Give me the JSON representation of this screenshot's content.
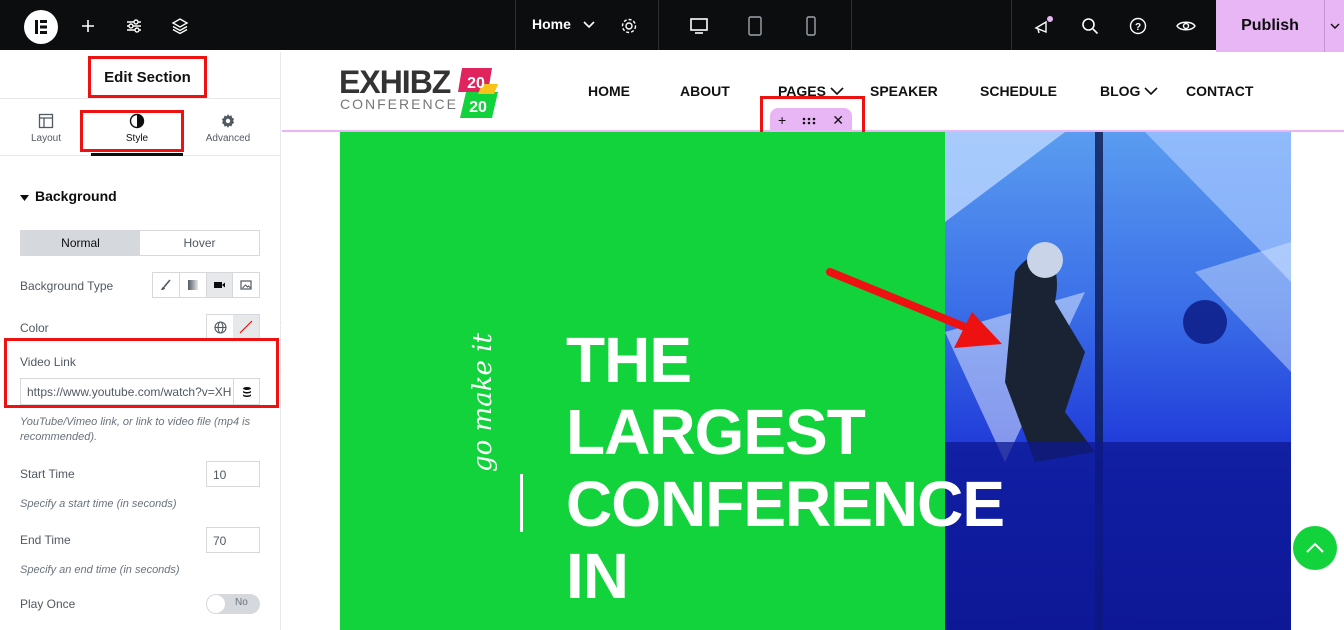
{
  "topbar": {
    "page_name": "Home",
    "publish_label": "Publish"
  },
  "panel": {
    "title": "Edit Section",
    "tabs": [
      {
        "label": "Layout"
      },
      {
        "label": "Style"
      },
      {
        "label": "Advanced"
      }
    ],
    "section_title": "Background",
    "state_toggle": [
      "Normal",
      "Hover"
    ],
    "background_type_label": "Background Type",
    "color_label": "Color",
    "video_link_label": "Video Link",
    "video_link_value": "https://www.youtube.com/watch?v=XH",
    "video_link_hint": "YouTube/Vimeo link, or link to video file (mp4 is recommended).",
    "start_time_label": "Start Time",
    "start_time_value": "10",
    "start_time_hint": "Specify a start time (in seconds)",
    "end_time_label": "End Time",
    "end_time_value": "70",
    "end_time_hint": "Specify an end time (in seconds)",
    "play_once_label": "Play Once",
    "play_once_value": "No"
  },
  "site": {
    "logo_text": "EXHIBZ",
    "logo_sub": "CONFERENCE",
    "logo_year_top": "20",
    "logo_year_bottom": "20",
    "nav": [
      "HOME",
      "ABOUT",
      "PAGES",
      "SPEAKER",
      "SCHEDULE",
      "BLOG",
      "CONTACT"
    ],
    "hero_script": "go make it",
    "hero_lines": [
      "THE",
      "LARGEST",
      "CONFERENCE",
      "IN"
    ]
  },
  "colors": {
    "accent": "#e8b5f5",
    "hero_green": "#12d33c",
    "highlight_red": "#e11111"
  }
}
